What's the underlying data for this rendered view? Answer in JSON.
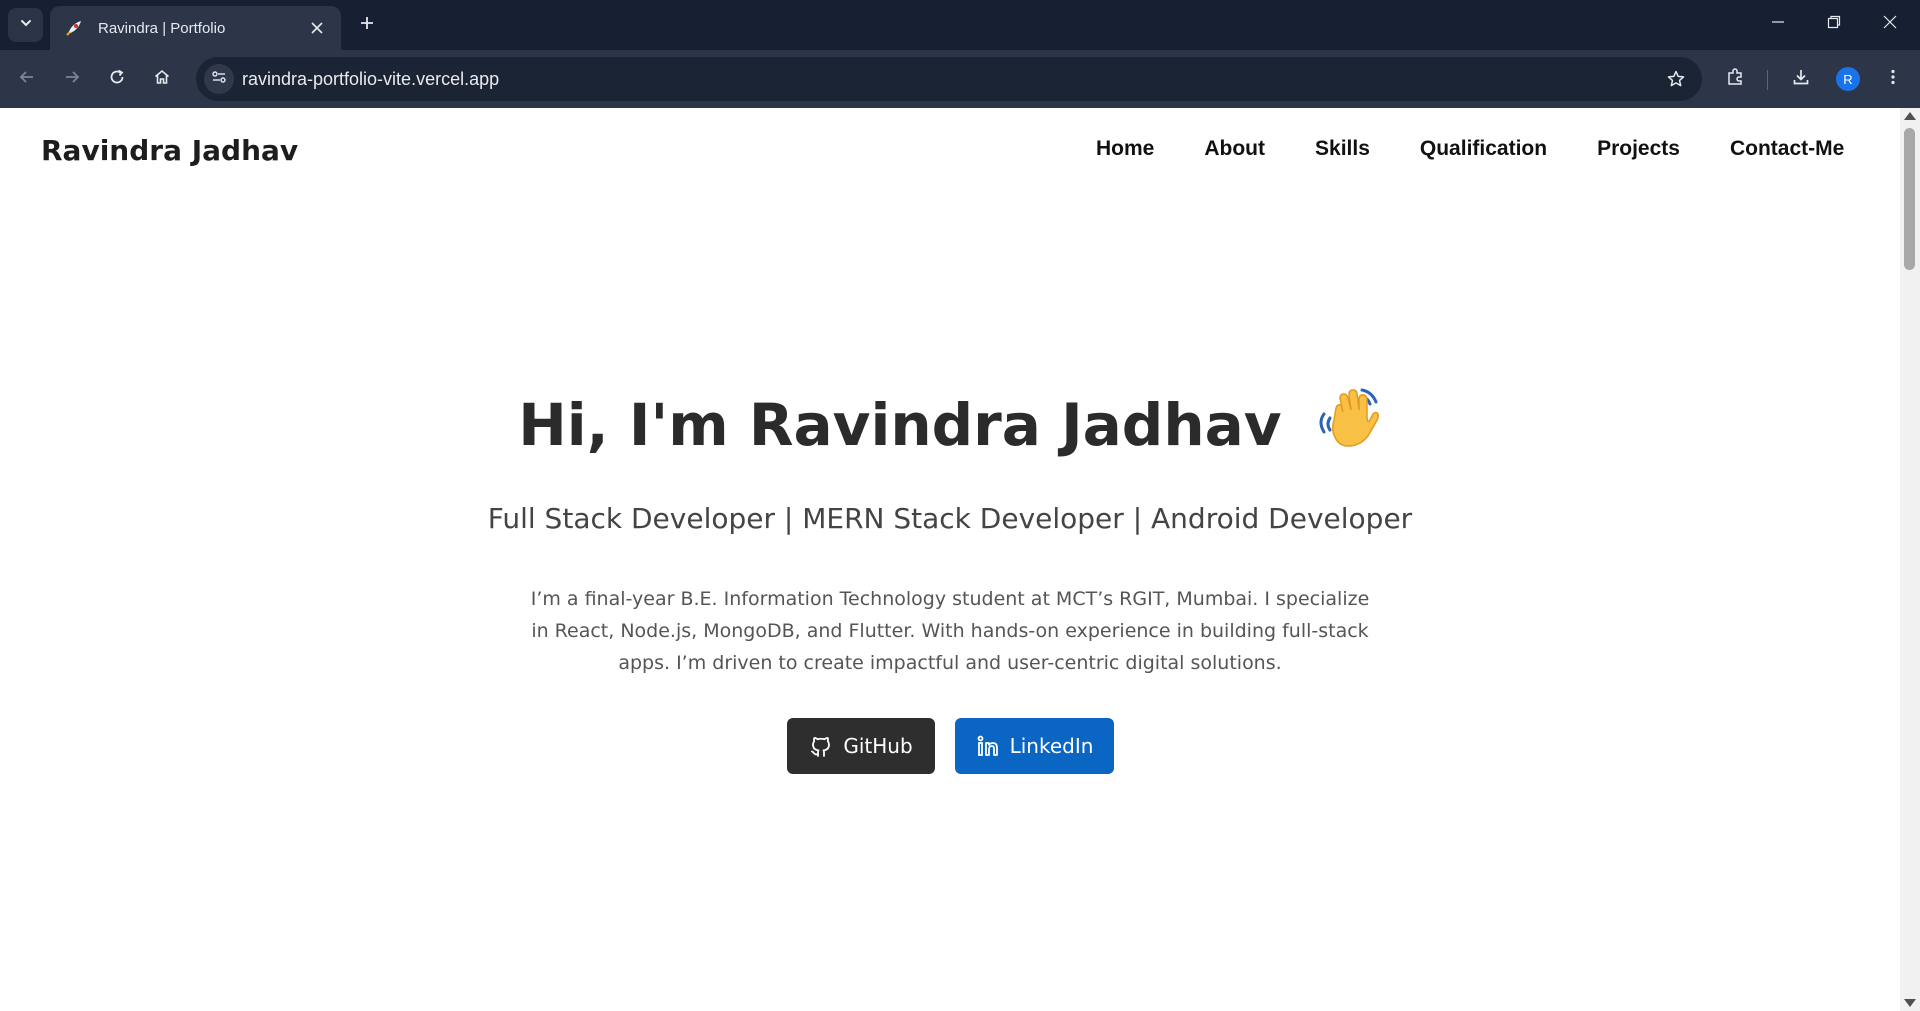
{
  "browser": {
    "tab": {
      "title": "Ravindra | Portfolio",
      "favicon_icon": "rocket-icon"
    },
    "address_bar": {
      "url": "ravindra-portfolio-vite.vercel.app"
    },
    "profile": {
      "initial": "R",
      "color": "#1a73e8"
    }
  },
  "page": {
    "brand": "Ravindra Jadhav",
    "nav": [
      {
        "label": "Home"
      },
      {
        "label": "About"
      },
      {
        "label": "Skills"
      },
      {
        "label": "Qualification"
      },
      {
        "label": "Projects"
      },
      {
        "label": "Contact-Me"
      }
    ],
    "hero": {
      "title": "Hi, I'm Ravindra Jadhav",
      "title_icon": "waving-hand-icon",
      "subtitle": "Full Stack Developer | MERN Stack Developer | Android Developer",
      "description": "I’m a final-year B.E. Information Technology student at MCT’s RGIT, Mumbai. I specialize in React, Node.js, MongoDB, and Flutter. With hands-on experience in building full-stack apps. I’m driven to create impactful and user-centric digital solutions."
    },
    "buttons": {
      "github": {
        "label": "GitHub",
        "icon": "github-icon",
        "color": "#2e2e2e"
      },
      "linkedin": {
        "label": "LinkedIn",
        "icon": "linkedin-icon",
        "color": "#0a66c2"
      }
    }
  }
}
